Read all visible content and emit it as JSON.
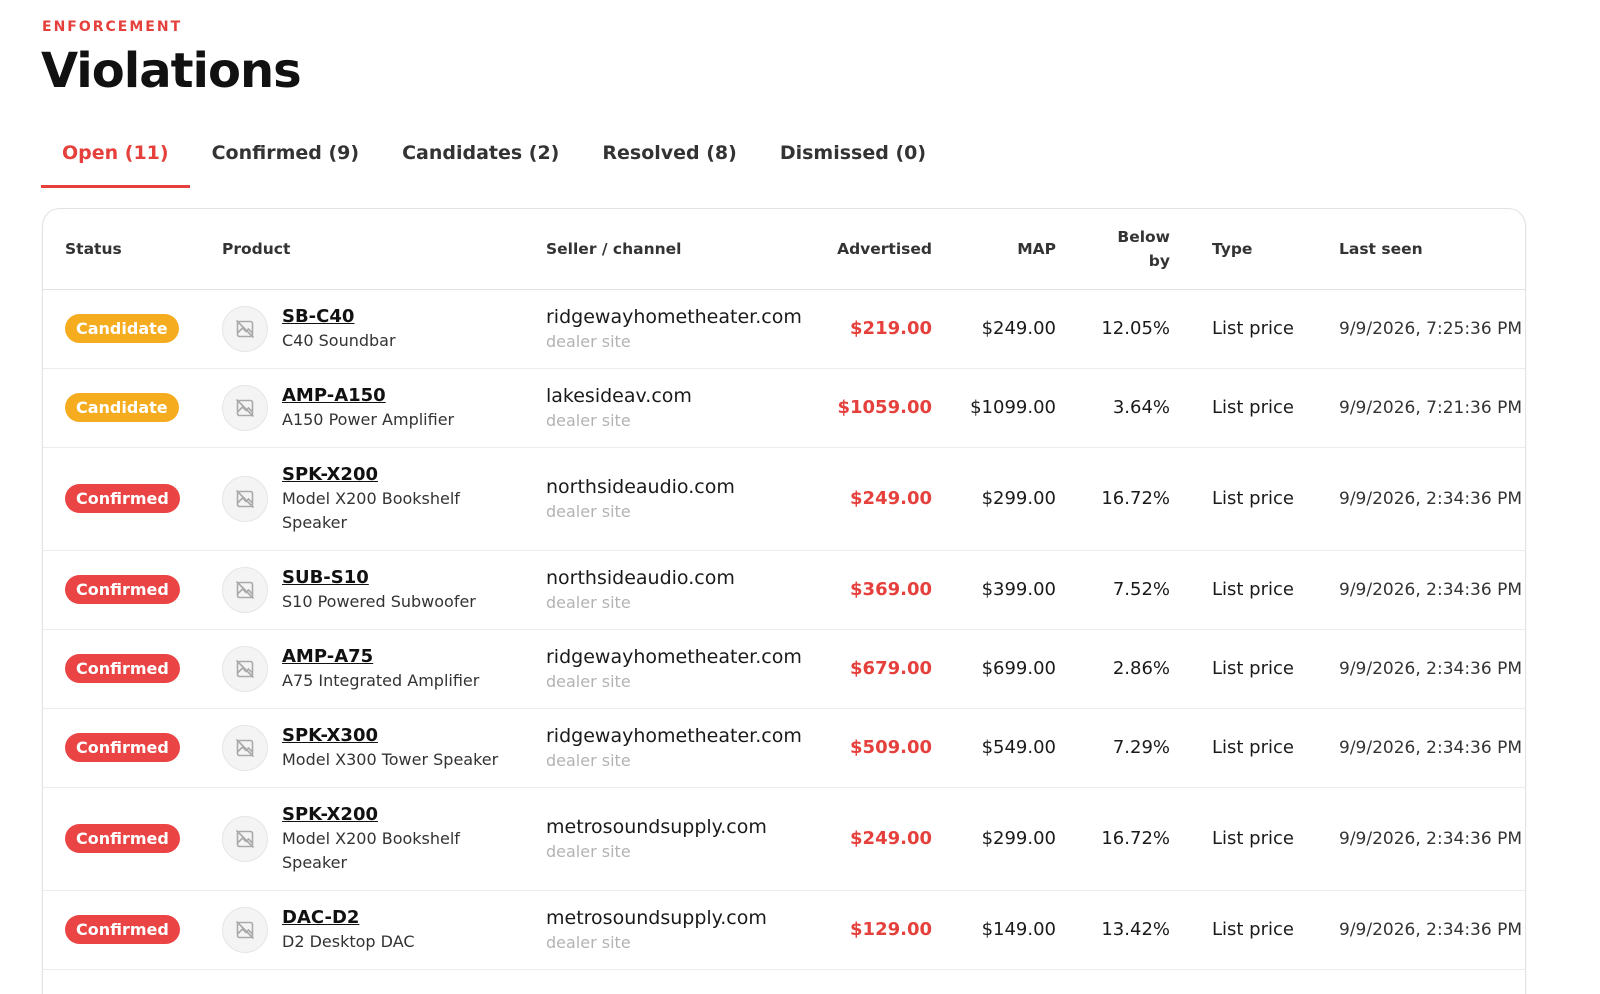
{
  "header": {
    "eyebrow": "ENFORCEMENT",
    "title": "Violations"
  },
  "tabs": [
    {
      "label": "Open (11)",
      "active": true
    },
    {
      "label": "Confirmed (9)",
      "active": false
    },
    {
      "label": "Candidates (2)",
      "active": false
    },
    {
      "label": "Resolved (8)",
      "active": false
    },
    {
      "label": "Dismissed (0)",
      "active": false
    }
  ],
  "table": {
    "columns": {
      "status": "Status",
      "product": "Product",
      "seller": "Seller / channel",
      "advertised": "Advertised",
      "map": "MAP",
      "below_line1": "Below",
      "below_line2": "by",
      "type": "Type",
      "last_seen": "Last seen"
    },
    "rows": [
      {
        "status": "Candidate",
        "sku": "SB-C40",
        "name": "C40 Soundbar",
        "seller": "ridgewayhometheater.com",
        "channel": "dealer site",
        "advertised": "$219.00",
        "map": "$249.00",
        "below": "12.05%",
        "type": "List price",
        "last_seen": "9/9/2026, 7:25:36 PM"
      },
      {
        "status": "Candidate",
        "sku": "AMP-A150",
        "name": "A150 Power Amplifier",
        "seller": "lakesideav.com",
        "channel": "dealer site",
        "advertised": "$1059.00",
        "map": "$1099.00",
        "below": "3.64%",
        "type": "List price",
        "last_seen": "9/9/2026, 7:21:36 PM"
      },
      {
        "status": "Confirmed",
        "sku": "SPK-X200",
        "name": "Model X200 Bookshelf Speaker",
        "seller": "northsideaudio.com",
        "channel": "dealer site",
        "advertised": "$249.00",
        "map": "$299.00",
        "below": "16.72%",
        "type": "List price",
        "last_seen": "9/9/2026, 2:34:36 PM"
      },
      {
        "status": "Confirmed",
        "sku": "SUB-S10",
        "name": "S10 Powered Subwoofer",
        "seller": "northsideaudio.com",
        "channel": "dealer site",
        "advertised": "$369.00",
        "map": "$399.00",
        "below": "7.52%",
        "type": "List price",
        "last_seen": "9/9/2026, 2:34:36 PM"
      },
      {
        "status": "Confirmed",
        "sku": "AMP-A75",
        "name": "A75 Integrated Amplifier",
        "seller": "ridgewayhometheater.com",
        "channel": "dealer site",
        "advertised": "$679.00",
        "map": "$699.00",
        "below": "2.86%",
        "type": "List price",
        "last_seen": "9/9/2026, 2:34:36 PM"
      },
      {
        "status": "Confirmed",
        "sku": "SPK-X300",
        "name": "Model X300 Tower Speaker",
        "seller": "ridgewayhometheater.com",
        "channel": "dealer site",
        "advertised": "$509.00",
        "map": "$549.00",
        "below": "7.29%",
        "type": "List price",
        "last_seen": "9/9/2026, 2:34:36 PM"
      },
      {
        "status": "Confirmed",
        "sku": "SPK-X200",
        "name": "Model X200 Bookshelf Speaker",
        "seller": "metrosoundsupply.com",
        "channel": "dealer site",
        "advertised": "$249.00",
        "map": "$299.00",
        "below": "16.72%",
        "type": "List price",
        "last_seen": "9/9/2026, 2:34:36 PM"
      },
      {
        "status": "Confirmed",
        "sku": "DAC-D2",
        "name": "D2 Desktop DAC",
        "seller": "metrosoundsupply.com",
        "channel": "dealer site",
        "advertised": "$129.00",
        "map": "$149.00",
        "below": "13.42%",
        "type": "List price",
        "last_seen": "9/9/2026, 2:34:36 PM"
      }
    ]
  },
  "icons": {
    "product_thumb": "image-unavailable-icon"
  },
  "colors": {
    "accent": "#e5403c",
    "candidate": "#f5ad1f",
    "confirmed": "#ea4444"
  }
}
